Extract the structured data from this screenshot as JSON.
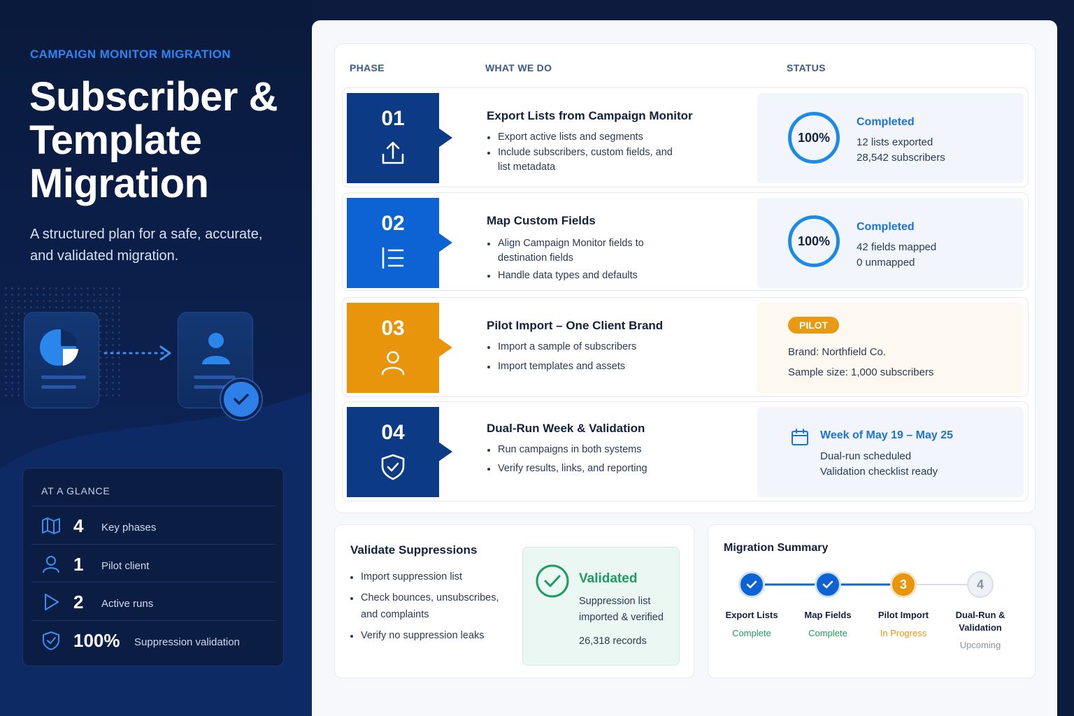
{
  "hero": {
    "eyebrow": "CAMPAIGN MONITOR MIGRATION",
    "title": "Subscriber & Template Migration",
    "subtitle": "A structured plan for a safe, accurate, and validated migration."
  },
  "glance": {
    "title": "AT A GLANCE",
    "rows": [
      {
        "icon": "map-icon",
        "value": "4",
        "label": "Key phases"
      },
      {
        "icon": "user-icon",
        "value": "1",
        "label": "Pilot client"
      },
      {
        "icon": "play-icon",
        "value": "2",
        "label": "Active runs"
      },
      {
        "icon": "shield-check-icon",
        "value": "100%",
        "label": "Suppression validation"
      }
    ]
  },
  "table": {
    "headers": {
      "phase": "PHASE",
      "what": "WHAT WE DO",
      "status": "STATUS"
    },
    "phases": [
      {
        "number": "01",
        "icon": "upload-icon",
        "color": "#0d3a85",
        "title": "Export Lists from Campaign Monitor",
        "bullets": [
          "Export active lists and segments",
          "Include subscribers, custom fields, and list metadata"
        ],
        "status": {
          "ring": "100%",
          "head": "Completed",
          "line1": "12 lists exported",
          "line2": "28,542 subscribers"
        }
      },
      {
        "number": "02",
        "icon": "list-icon",
        "color": "#0d63d4",
        "title": "Map Custom Fields",
        "bullets": [
          "Align Campaign Monitor fields to destination fields",
          "Handle data types and defaults"
        ],
        "status": {
          "ring": "100%",
          "head": "Completed",
          "line1": "42 fields mapped",
          "line2": "0 unmapped"
        }
      },
      {
        "number": "03",
        "icon": "user-icon",
        "color": "#e8950c",
        "title": "Pilot Import – One Client Brand",
        "bullets": [
          "Import a sample of subscribers",
          "Import templates and assets"
        ],
        "status": {
          "pill": "PILOT",
          "line1": "Brand: Northfield Co.",
          "line2": "Sample size: 1,000 subscribers"
        }
      },
      {
        "number": "04",
        "icon": "shield-check-icon",
        "color": "#0d3a85",
        "title": "Dual-Run Week & Validation",
        "bullets": [
          "Run campaigns in both systems",
          "Verify results, links, and reporting"
        ],
        "status": {
          "icon": "calendar-icon",
          "head": "Week of May 19 – May 25",
          "line1": "Dual-run scheduled",
          "line2": "Validation checklist ready"
        }
      }
    ]
  },
  "suppressions": {
    "title": "Validate Suppressions",
    "bullets": [
      "Import suppression list",
      "Check bounces, unsubscribes, and complaints",
      "Verify no suppression leaks"
    ],
    "result": {
      "head": "Validated",
      "line1": "Suppression list imported & verified",
      "records": "26,318 records"
    }
  },
  "summary": {
    "title": "Migration Summary",
    "steps": [
      {
        "marker": "",
        "label": "Export Lists",
        "state": "Complete",
        "kind": "done"
      },
      {
        "marker": "",
        "label": "Map Fields",
        "state": "Complete",
        "kind": "done"
      },
      {
        "marker": "3",
        "label": "Pilot Import",
        "state": "In Progress",
        "kind": "active"
      },
      {
        "marker": "4",
        "label": "Dual-Run & Validation",
        "state": "Upcoming",
        "kind": "todo"
      }
    ],
    "colors": {
      "done": "#0d63d4",
      "active": "#e8950c",
      "todo": "#eef1f5",
      "complete_text": "#1e9a63",
      "progress_text": "#e8950c",
      "upcoming_text": "#8a94a6"
    }
  }
}
